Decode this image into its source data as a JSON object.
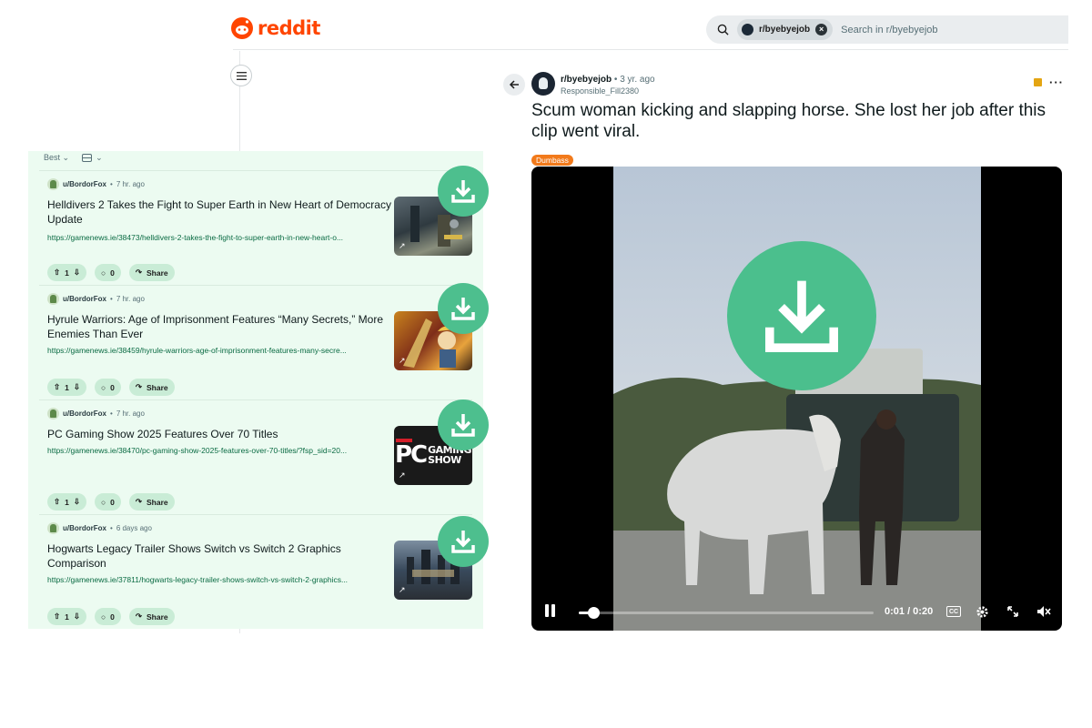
{
  "header": {
    "logo_text": "reddit",
    "search_chip": "r/byebyejob",
    "search_placeholder": "Search in r/byebyejob"
  },
  "feed": {
    "sort_label": "Best",
    "posts": [
      {
        "user": "u/BordorFox",
        "age": "7 hr. ago",
        "title": "Helldivers 2 Takes the Fight to Super Earth in New Heart of Democracy Update",
        "link": "https://gamenews.ie/38473/helldivers-2-takes-the-fight-to-super-earth-in-new-heart-o...",
        "votes": "1",
        "comments": "0",
        "share": "Share"
      },
      {
        "user": "u/BordorFox",
        "age": "7 hr. ago",
        "title": "Hyrule Warriors: Age of Imprisonment Features “Many Secrets,” More Enemies Than Ever",
        "link": "https://gamenews.ie/38459/hyrule-warriors-age-of-imprisonment-features-many-secre...",
        "votes": "1",
        "comments": "0",
        "share": "Share"
      },
      {
        "user": "u/BordorFox",
        "age": "7 hr. ago",
        "title": "PC Gaming Show 2025 Features Over 70 Titles",
        "link": "https://gamenews.ie/38470/pc-gaming-show-2025-features-over-70-titles/?fsp_sid=20...",
        "votes": "1",
        "comments": "0",
        "share": "Share",
        "thumb_text_1": "PC",
        "thumb_text_2": "GAMING",
        "thumb_text_3": "SHOW"
      },
      {
        "user": "u/BordorFox",
        "age": "6 days ago",
        "title": "Hogwarts Legacy Trailer Shows Switch vs Switch 2 Graphics Comparison",
        "link": "https://gamenews.ie/37811/hogwarts-legacy-trailer-shows-switch-vs-switch-2-graphics...",
        "votes": "1",
        "comments": "0",
        "share": "Share"
      }
    ]
  },
  "main_post": {
    "subreddit": "r/byebyejob",
    "age": "3 yr. ago",
    "author": "Responsible_Fill2380",
    "title": "Scum woman kicking and slapping horse. She lost her job after this clip went viral.",
    "flair": "Dumbass",
    "video": {
      "time": "0:01 / 0:20",
      "progress": 0.05,
      "cc_label": "CC"
    }
  },
  "colors": {
    "brand": "#ff4500",
    "download_green": "#4bbf8d",
    "feed_bg": "#ecfbf1",
    "flair": "#f27a1b"
  }
}
